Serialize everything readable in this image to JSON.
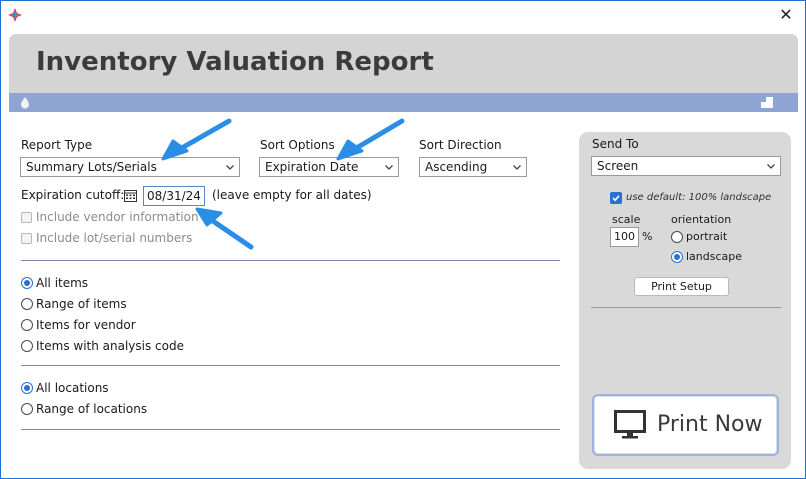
{
  "window": {
    "close_glyph": "✕"
  },
  "banner": {
    "title": "Inventory Valuation Report"
  },
  "report_type": {
    "label": "Report Type",
    "value": "Summary Lots/Serials"
  },
  "sort_options": {
    "label": "Sort Options",
    "value": "Expiration Date"
  },
  "sort_direction": {
    "label": "Sort Direction",
    "value": "Ascending"
  },
  "expiration": {
    "label": "Expiration cutoff:",
    "value": "08/31/24",
    "hint": "(leave empty for all dates)"
  },
  "checkboxes": {
    "vendor": "Include vendor information",
    "lot_serial": "Include lot/serial numbers"
  },
  "item_scope": {
    "selected": "All items",
    "options": [
      "All items",
      "Range of items",
      "Items for vendor",
      "Items with analysis code"
    ]
  },
  "location_scope": {
    "selected": "All locations",
    "options": [
      "All locations",
      "Range of locations"
    ]
  },
  "send_to": {
    "label": "Send To",
    "value": "Screen",
    "use_default": "use default: 100% landscape",
    "scale_label": "scale",
    "scale_value": "100",
    "percent": "%",
    "orientation_label": "orientation",
    "orientation_options": [
      "portrait",
      "landscape"
    ],
    "orientation_selected": "landscape",
    "print_setup": "Print Setup",
    "print_now": "Print Now"
  },
  "colors": {
    "accent": "#2a6fd1",
    "strip": "#8ea5d4",
    "annotation_arrow": "#2b8ee6"
  }
}
